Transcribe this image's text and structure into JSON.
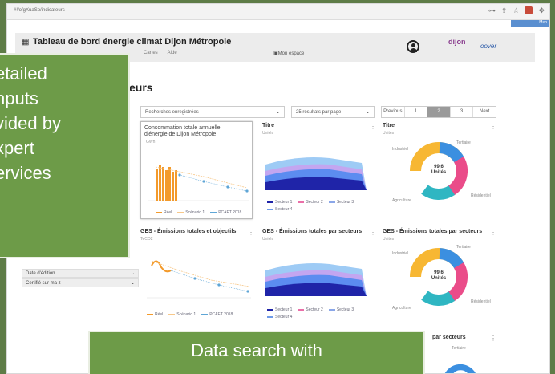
{
  "browser": {
    "url": "#!/ofgXuaSp/indicateurs"
  },
  "topstrip": {
    "label": "Men"
  },
  "header": {
    "title": "Tableau de bord énergie climat Dijon Métropole",
    "nav": [
      "Cartes",
      "Aide"
    ],
    "space": "Mon espace",
    "logo_dijon": "dijon",
    "logo_secondary": "oover"
  },
  "page": {
    "title": "eurs"
  },
  "controls": {
    "search": "Recherches enregistrées",
    "perpage": "25 résultats par page",
    "pager": [
      "Previous",
      "1",
      "2",
      "3",
      "Next"
    ]
  },
  "filters": [
    {
      "label": "Date d'édition"
    },
    {
      "label": "Certifié sur ma z"
    }
  ],
  "cards": [
    {
      "title": "Consommation totale annuelle",
      "title2": "d'énergie de Dijon Métropole",
      "unit": "GWh",
      "legend": [
        "Réel",
        "Scénario 1",
        "PCAET 2018"
      ]
    },
    {
      "title": "Titre",
      "unit": "Unités",
      "legend": [
        "Secteur 1",
        "Secteur 2",
        "Secteur 3",
        "Secteur 4"
      ]
    },
    {
      "title": "Titre",
      "unit": "Unités",
      "center": "99,6",
      "center2": "Unités",
      "labels": [
        "Tertiaire",
        "Industriel",
        "Résidentiel",
        "Agriculture"
      ]
    },
    {
      "title": "GES - Émissions totales et objectifs",
      "unit": "TeCO2",
      "legend": [
        "Réel",
        "Scénario 1",
        "PCAET 2018"
      ]
    },
    {
      "title": "GES - Émissions totales par secteurs",
      "unit": "Unités",
      "legend": [
        "Secteur 1",
        "Secteur 2",
        "Secteur 3",
        "Secteur 4"
      ]
    },
    {
      "title": "GES - Émissions totales par secteurs",
      "unit": "Unités",
      "center": "99,6",
      "center2": "Unités",
      "labels": [
        "Tertiaire",
        "Industriel",
        "Résidentiel",
        "Agriculture"
      ]
    },
    {
      "title": "par secteurs",
      "labels": [
        "Tertiaire"
      ]
    }
  ],
  "overlays": {
    "left": [
      "etailed",
      "nputs",
      "vided by",
      "xpert",
      "ervices"
    ],
    "bottom": "Data search with"
  },
  "colors": {
    "orange": "#f39a2b",
    "blue": "#3b6fd4",
    "donut": [
      "#f7b733",
      "#ea4c89",
      "#2fb6c2",
      "#3b8fe0"
    ]
  }
}
